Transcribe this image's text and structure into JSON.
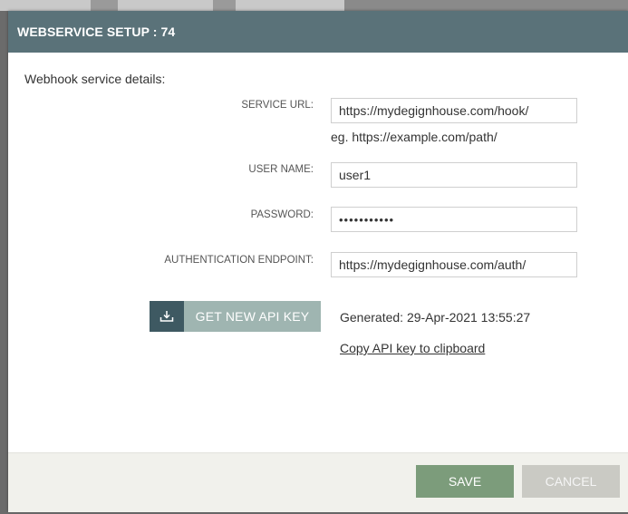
{
  "dialog": {
    "title": "WEBSERVICE SETUP : 74",
    "subtitle": "Webhook service details:"
  },
  "form": {
    "service_url": {
      "label": "SERVICE URL:",
      "value": "https://mydegignhouse.com/hook/",
      "hint": "eg. https://example.com/path/"
    },
    "user_name": {
      "label": "USER NAME:",
      "value": "user1"
    },
    "password": {
      "label": "PASSWORD:",
      "value": "•••••••••••"
    },
    "auth_endpoint": {
      "label": "AUTHENTICATION ENDPOINT:",
      "value": "https://mydegignhouse.com/auth/"
    }
  },
  "api_key": {
    "button_label": "GET NEW API KEY",
    "icon": "download-icon",
    "generated_text": "Generated: 29-Apr-2021 13:55:27",
    "copy_link": "Copy API key to clipboard"
  },
  "footer": {
    "save_label": "SAVE",
    "cancel_label": "CANCEL"
  },
  "colors": {
    "titlebar": "#5a7279",
    "api_icon_bg": "#3e5962",
    "api_label_bg": "#9fb5b1",
    "save_bg": "#7c9c7b",
    "cancel_bg": "#cacac4"
  }
}
